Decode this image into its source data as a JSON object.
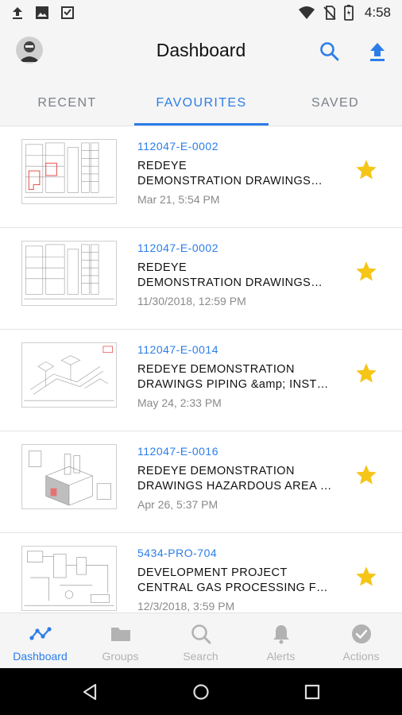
{
  "status_bar": {
    "time": "4:58",
    "icons": [
      "upload-icon",
      "image-icon",
      "download-done-icon",
      "wifi-icon",
      "no-sim-icon",
      "battery-icon"
    ]
  },
  "app_bar": {
    "title": "Dashboard",
    "actions": [
      "search-icon",
      "upload-icon"
    ]
  },
  "tabs": [
    {
      "label": "RECENT",
      "active": false
    },
    {
      "label": "FAVOURITES",
      "active": true
    },
    {
      "label": "SAVED",
      "active": false
    }
  ],
  "documents": [
    {
      "id": "112047-E-0002",
      "title_line1": "REDEYE",
      "title_line2": "DEMONSTRATION DRAWINGS…",
      "date": "Mar 21, 5:54 PM",
      "favourite": true
    },
    {
      "id": "112047-E-0002",
      "title_line1": "REDEYE",
      "title_line2": "DEMONSTRATION DRAWINGS…",
      "date": "11/30/2018, 12:59 PM",
      "favourite": true
    },
    {
      "id": "112047-E-0014",
      "title_line1": "REDEYE DEMONSTRATION",
      "title_line2": "DRAWINGS PIPING &amp; INST…",
      "date": "May 24, 2:33 PM",
      "favourite": true
    },
    {
      "id": "112047-E-0016",
      "title_line1": "REDEYE DEMONSTRATION",
      "title_line2": "DRAWINGS HAZARDOUS AREA …",
      "date": "Apr 26, 5:37 PM",
      "favourite": true
    },
    {
      "id": "5434-PRO-704",
      "title_line1": "DEVELOPMENT PROJECT",
      "title_line2": "CENTRAL GAS PROCESSING F…",
      "date": "12/3/2018, 3:59 PM",
      "favourite": true
    }
  ],
  "bottom_nav": [
    {
      "label": "Dashboard",
      "icon": "dashboard-line-icon",
      "active": true
    },
    {
      "label": "Groups",
      "icon": "folder-icon",
      "active": false
    },
    {
      "label": "Search",
      "icon": "search-icon",
      "active": false
    },
    {
      "label": "Alerts",
      "icon": "bell-icon",
      "active": false
    },
    {
      "label": "Actions",
      "icon": "check-circle-icon",
      "active": false
    }
  ],
  "colors": {
    "accent": "#2b7de9",
    "star": "#f5c518",
    "inactive": "#b2b2b2",
    "bar_background": "#f5f5f5"
  }
}
